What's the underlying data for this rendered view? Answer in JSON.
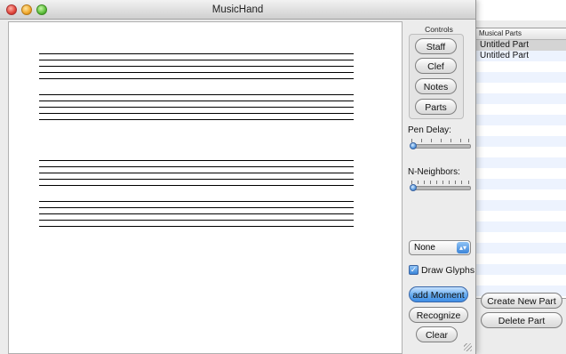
{
  "window": {
    "title": "MusicHand"
  },
  "controls": {
    "label": "Controls",
    "buttons": [
      "Staff",
      "Clef",
      "Notes",
      "Parts"
    ]
  },
  "pen_delay": {
    "label": "Pen Delay:"
  },
  "n_neighbors": {
    "label": "N-Neighbors:"
  },
  "popup": {
    "selected": "None"
  },
  "draw_glyphs": {
    "label": "Draw Glyphs",
    "checked": true
  },
  "actions": {
    "add_moment": "add Moment",
    "recognize": "Recognize",
    "clear": "Clear"
  },
  "parts": {
    "header": "Musical Parts",
    "rows": [
      "Untitled Part",
      "Untitled Part"
    ],
    "create_button": "Create New Part",
    "delete_button": "Delete Part"
  },
  "colors": {
    "accent": "#3f8ee6",
    "row_alt": "#edf3fe"
  }
}
